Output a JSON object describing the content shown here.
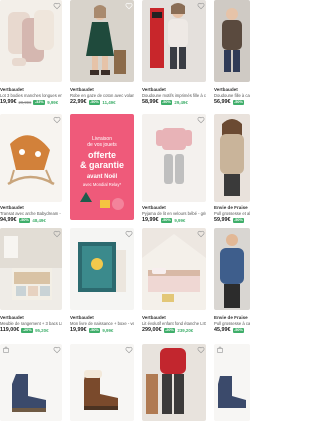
{
  "products": [
    {
      "brand": "Vertbaudet",
      "title": "Lot 3 bodies manches longues en coton bio",
      "price": "19,99€",
      "old": "29,99€",
      "badge": "-33%",
      "member": "9,99€"
    },
    {
      "brand": "Vertbaudet",
      "title": "Robe en gaze de coton avec volants",
      "price": "22,99€",
      "old": "",
      "badge": "-50%",
      "member": "11,49€"
    },
    {
      "brand": "Vertbaudet",
      "title": "Doudoune motifs imprimés fille à capuche",
      "price": "58,99€",
      "old": "",
      "badge": "-50%",
      "member": "29,49€"
    },
    {
      "brand": "Vertbaudet",
      "title": "Doudoune fille à capuche",
      "price": "56,99€",
      "old": "",
      "badge": "-50%",
      "member": "28,49€"
    },
    {
      "brand": "Vertbaudet",
      "title": "Transat avec arche Babydream - coral",
      "price": "94,99€",
      "old": "",
      "badge": "-50%",
      "member": "48,49€"
    },
    {
      "brand": "",
      "title": "",
      "price": "",
      "old": "",
      "badge": "",
      "member": ""
    },
    {
      "brand": "Vertbaudet",
      "title": "Pyjama de lit en velours bébé - gris",
      "price": "19,99€",
      "old": "",
      "badge": "-50%",
      "member": "9,99€"
    },
    {
      "brand": "Envie de Fraise",
      "title": "Pull grossesse et allaitement",
      "price": "59,99€",
      "old": "",
      "badge": "-50%",
      "member": "29,99€"
    },
    {
      "brand": "Vertbaudet",
      "title": "Meuble de rangement + 3 bacs LINEO",
      "price": "119,00€",
      "old": "",
      "badge": "-20%",
      "member": "95,20€"
    },
    {
      "brand": "Vertbaudet",
      "title": "Mon livre de naissance + boxe - vert",
      "price": "19,99€",
      "old": "",
      "badge": "-50%",
      "member": "9,99€"
    },
    {
      "brand": "Vertbaudet",
      "title": "Lit évolutif enfant fond étanche LIGNE",
      "price": "299,00€",
      "old": "",
      "badge": "-20%",
      "member": "239,20€"
    },
    {
      "brand": "Envie de Fraise",
      "title": "Pull grossesse à cable",
      "price": "45,99€",
      "old": "",
      "badge": "-50%",
      "member": "22,99€"
    },
    {
      "brand": "",
      "title": "",
      "price": "",
      "old": "",
      "badge": "",
      "member": ""
    },
    {
      "brand": "",
      "title": "",
      "price": "",
      "old": "",
      "badge": "",
      "member": ""
    },
    {
      "brand": "",
      "title": "",
      "price": "",
      "old": "",
      "badge": "",
      "member": ""
    },
    {
      "brand": "",
      "title": "",
      "price": "",
      "old": "",
      "badge": "",
      "member": ""
    }
  ],
  "promo": {
    "line1": "Livraison",
    "line2": "de vos jouets",
    "line3": "offerte",
    "line4": "& garantie",
    "line5": "avant Noël",
    "line6": "avec Mondial Relay*"
  },
  "colors": {
    "accent": "#3fae6a",
    "promo_bg": "#ef5a7a"
  }
}
